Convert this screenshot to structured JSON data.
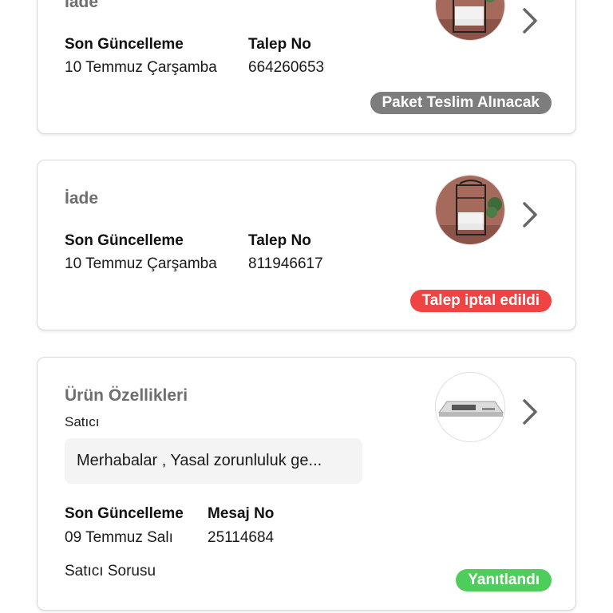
{
  "colors": {
    "badge_gray": "#7d7d7d",
    "badge_red": "#ef4444",
    "badge_green": "#4fcd5c"
  },
  "cards": [
    {
      "title": "İade",
      "last_update_label": "Son Güncelleme",
      "last_update_value": "10 Temmuz Çarşamba",
      "id_label": "Talep No",
      "id_value": "664260653",
      "status": "Paket Teslim Alınacak",
      "thumbnail_icon": "kitchen-shelf-product-image",
      "chevron_icon": "chevron-right-icon"
    },
    {
      "title": "İade",
      "last_update_label": "Son Güncelleme",
      "last_update_value": "10 Temmuz Çarşamba",
      "id_label": "Talep No",
      "id_value": "811946617",
      "status": "Talep iptal edildi",
      "thumbnail_icon": "kitchen-shelf-product-image",
      "chevron_icon": "chevron-right-icon"
    },
    {
      "title": "Ürün Özellikleri",
      "sender": "Satıcı",
      "message_preview": "Merhabalar , Yasal zorunluluk ge...",
      "last_update_label": "Son Güncelleme",
      "last_update_value": "09 Temmuz Salı",
      "id_label": "Mesaj No",
      "id_value": "25114684",
      "question_type": "Satıcı Sorusu",
      "status": "Yanıtlandı",
      "thumbnail_icon": "range-hood-product-image",
      "chevron_icon": "chevron-right-icon"
    }
  ]
}
